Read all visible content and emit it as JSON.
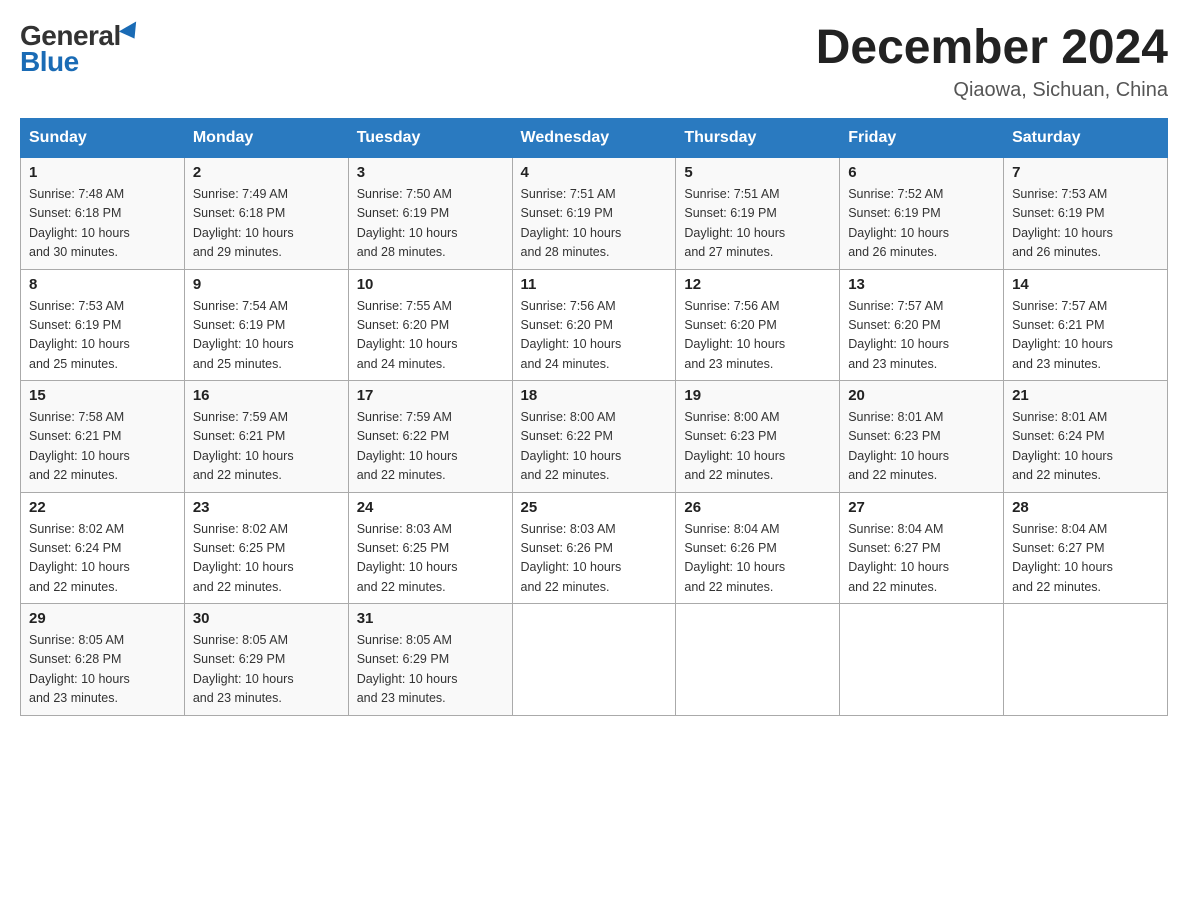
{
  "header": {
    "logo_general": "General",
    "logo_blue": "Blue",
    "month_title": "December 2024",
    "location": "Qiaowa, Sichuan, China"
  },
  "weekdays": [
    "Sunday",
    "Monday",
    "Tuesday",
    "Wednesday",
    "Thursday",
    "Friday",
    "Saturday"
  ],
  "weeks": [
    [
      {
        "day": "1",
        "sunrise": "7:48 AM",
        "sunset": "6:18 PM",
        "daylight": "10 hours and 30 minutes."
      },
      {
        "day": "2",
        "sunrise": "7:49 AM",
        "sunset": "6:18 PM",
        "daylight": "10 hours and 29 minutes."
      },
      {
        "day": "3",
        "sunrise": "7:50 AM",
        "sunset": "6:19 PM",
        "daylight": "10 hours and 28 minutes."
      },
      {
        "day": "4",
        "sunrise": "7:51 AM",
        "sunset": "6:19 PM",
        "daylight": "10 hours and 28 minutes."
      },
      {
        "day": "5",
        "sunrise": "7:51 AM",
        "sunset": "6:19 PM",
        "daylight": "10 hours and 27 minutes."
      },
      {
        "day": "6",
        "sunrise": "7:52 AM",
        "sunset": "6:19 PM",
        "daylight": "10 hours and 26 minutes."
      },
      {
        "day": "7",
        "sunrise": "7:53 AM",
        "sunset": "6:19 PM",
        "daylight": "10 hours and 26 minutes."
      }
    ],
    [
      {
        "day": "8",
        "sunrise": "7:53 AM",
        "sunset": "6:19 PM",
        "daylight": "10 hours and 25 minutes."
      },
      {
        "day": "9",
        "sunrise": "7:54 AM",
        "sunset": "6:19 PM",
        "daylight": "10 hours and 25 minutes."
      },
      {
        "day": "10",
        "sunrise": "7:55 AM",
        "sunset": "6:20 PM",
        "daylight": "10 hours and 24 minutes."
      },
      {
        "day": "11",
        "sunrise": "7:56 AM",
        "sunset": "6:20 PM",
        "daylight": "10 hours and 24 minutes."
      },
      {
        "day": "12",
        "sunrise": "7:56 AM",
        "sunset": "6:20 PM",
        "daylight": "10 hours and 23 minutes."
      },
      {
        "day": "13",
        "sunrise": "7:57 AM",
        "sunset": "6:20 PM",
        "daylight": "10 hours and 23 minutes."
      },
      {
        "day": "14",
        "sunrise": "7:57 AM",
        "sunset": "6:21 PM",
        "daylight": "10 hours and 23 minutes."
      }
    ],
    [
      {
        "day": "15",
        "sunrise": "7:58 AM",
        "sunset": "6:21 PM",
        "daylight": "10 hours and 22 minutes."
      },
      {
        "day": "16",
        "sunrise": "7:59 AM",
        "sunset": "6:21 PM",
        "daylight": "10 hours and 22 minutes."
      },
      {
        "day": "17",
        "sunrise": "7:59 AM",
        "sunset": "6:22 PM",
        "daylight": "10 hours and 22 minutes."
      },
      {
        "day": "18",
        "sunrise": "8:00 AM",
        "sunset": "6:22 PM",
        "daylight": "10 hours and 22 minutes."
      },
      {
        "day": "19",
        "sunrise": "8:00 AM",
        "sunset": "6:23 PM",
        "daylight": "10 hours and 22 minutes."
      },
      {
        "day": "20",
        "sunrise": "8:01 AM",
        "sunset": "6:23 PM",
        "daylight": "10 hours and 22 minutes."
      },
      {
        "day": "21",
        "sunrise": "8:01 AM",
        "sunset": "6:24 PM",
        "daylight": "10 hours and 22 minutes."
      }
    ],
    [
      {
        "day": "22",
        "sunrise": "8:02 AM",
        "sunset": "6:24 PM",
        "daylight": "10 hours and 22 minutes."
      },
      {
        "day": "23",
        "sunrise": "8:02 AM",
        "sunset": "6:25 PM",
        "daylight": "10 hours and 22 minutes."
      },
      {
        "day": "24",
        "sunrise": "8:03 AM",
        "sunset": "6:25 PM",
        "daylight": "10 hours and 22 minutes."
      },
      {
        "day": "25",
        "sunrise": "8:03 AM",
        "sunset": "6:26 PM",
        "daylight": "10 hours and 22 minutes."
      },
      {
        "day": "26",
        "sunrise": "8:04 AM",
        "sunset": "6:26 PM",
        "daylight": "10 hours and 22 minutes."
      },
      {
        "day": "27",
        "sunrise": "8:04 AM",
        "sunset": "6:27 PM",
        "daylight": "10 hours and 22 minutes."
      },
      {
        "day": "28",
        "sunrise": "8:04 AM",
        "sunset": "6:27 PM",
        "daylight": "10 hours and 22 minutes."
      }
    ],
    [
      {
        "day": "29",
        "sunrise": "8:05 AM",
        "sunset": "6:28 PM",
        "daylight": "10 hours and 23 minutes."
      },
      {
        "day": "30",
        "sunrise": "8:05 AM",
        "sunset": "6:29 PM",
        "daylight": "10 hours and 23 minutes."
      },
      {
        "day": "31",
        "sunrise": "8:05 AM",
        "sunset": "6:29 PM",
        "daylight": "10 hours and 23 minutes."
      },
      null,
      null,
      null,
      null
    ]
  ],
  "labels": {
    "sunrise": "Sunrise:",
    "sunset": "Sunset:",
    "daylight": "Daylight:"
  }
}
